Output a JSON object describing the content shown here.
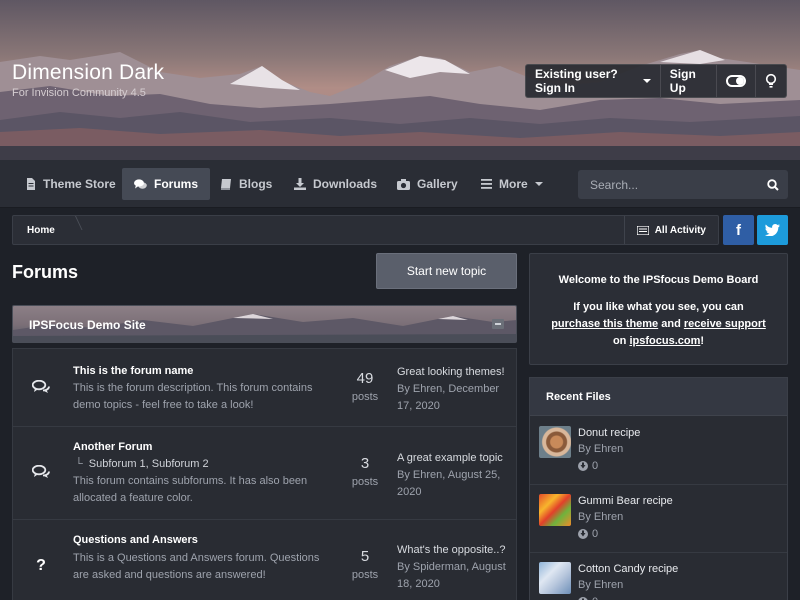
{
  "site": {
    "title": "Dimension Dark",
    "subtitle": "For Invision Community 4.5"
  },
  "userbar": {
    "sign_in": "Existing user? Sign In",
    "sign_up": "Sign Up"
  },
  "nav": {
    "items": [
      {
        "label": "Theme Store",
        "icon": "document-icon"
      },
      {
        "label": "Forums",
        "icon": "comments-icon",
        "active": true
      },
      {
        "label": "Blogs",
        "icon": "book-icon"
      },
      {
        "label": "Downloads",
        "icon": "download-icon"
      },
      {
        "label": "Gallery",
        "icon": "camera-icon"
      },
      {
        "label": "More",
        "icon": "menu-icon"
      }
    ],
    "search_placeholder": "Search..."
  },
  "breadcrumb": {
    "home": "Home",
    "all_activity": "All Activity"
  },
  "social": {
    "facebook": "f",
    "twitter": "twitter-bird"
  },
  "main": {
    "title": "Forums",
    "start_topic": "Start new topic",
    "category": "IPSFocus Demo Site",
    "forums": [
      {
        "name": "This is the forum name",
        "description": "This is the forum description. This forum contains demo topics - feel free to take a look!",
        "icon": "comments-icon",
        "count": "49",
        "count_label": "posts",
        "last_title": "Great looking themes!",
        "last_meta": "By Ehren, December 17, 2020"
      },
      {
        "name": "Another Forum",
        "subforums": "Subforum 1,   Subforum 2",
        "description": "This forum contains subforums. It has also been allocated a feature color.",
        "icon": "comments-icon",
        "count": "3",
        "count_label": "posts",
        "last_title": "A great example topic",
        "last_meta": "By Ehren, August 25, 2020"
      },
      {
        "name": "Questions and Answers",
        "description": "This is a Questions and Answers forum. Questions are asked and questions are answered!",
        "icon": "question-icon",
        "count": "5",
        "count_label": "posts",
        "last_title": "What's the opposite..?",
        "last_meta": "By Spiderman, August 18, 2020"
      }
    ]
  },
  "sidebar": {
    "welcome_title": "Welcome to the IPSfocus Demo Board",
    "welcome_pre": "If you like what you see, you can",
    "welcome_link1": "purchase this theme",
    "welcome_mid": "and",
    "welcome_link2": "receive support",
    "welcome_on": "on",
    "welcome_link3": "ipsfocus.com",
    "welcome_end": "!",
    "recent_title": "Recent Files",
    "files": [
      {
        "name": "Donut recipe",
        "by": "By Ehren",
        "downloads": "0"
      },
      {
        "name": "Gummi Bear recipe",
        "by": "By Ehren",
        "downloads": "0"
      },
      {
        "name": "Cotton Candy recipe",
        "by": "By Ehren",
        "downloads": "0"
      }
    ]
  },
  "colors": {
    "accent_button": "#5a5f6b",
    "facebook": "#2f5ea5",
    "twitter": "#1d9bdb",
    "background": "#1e2128"
  }
}
